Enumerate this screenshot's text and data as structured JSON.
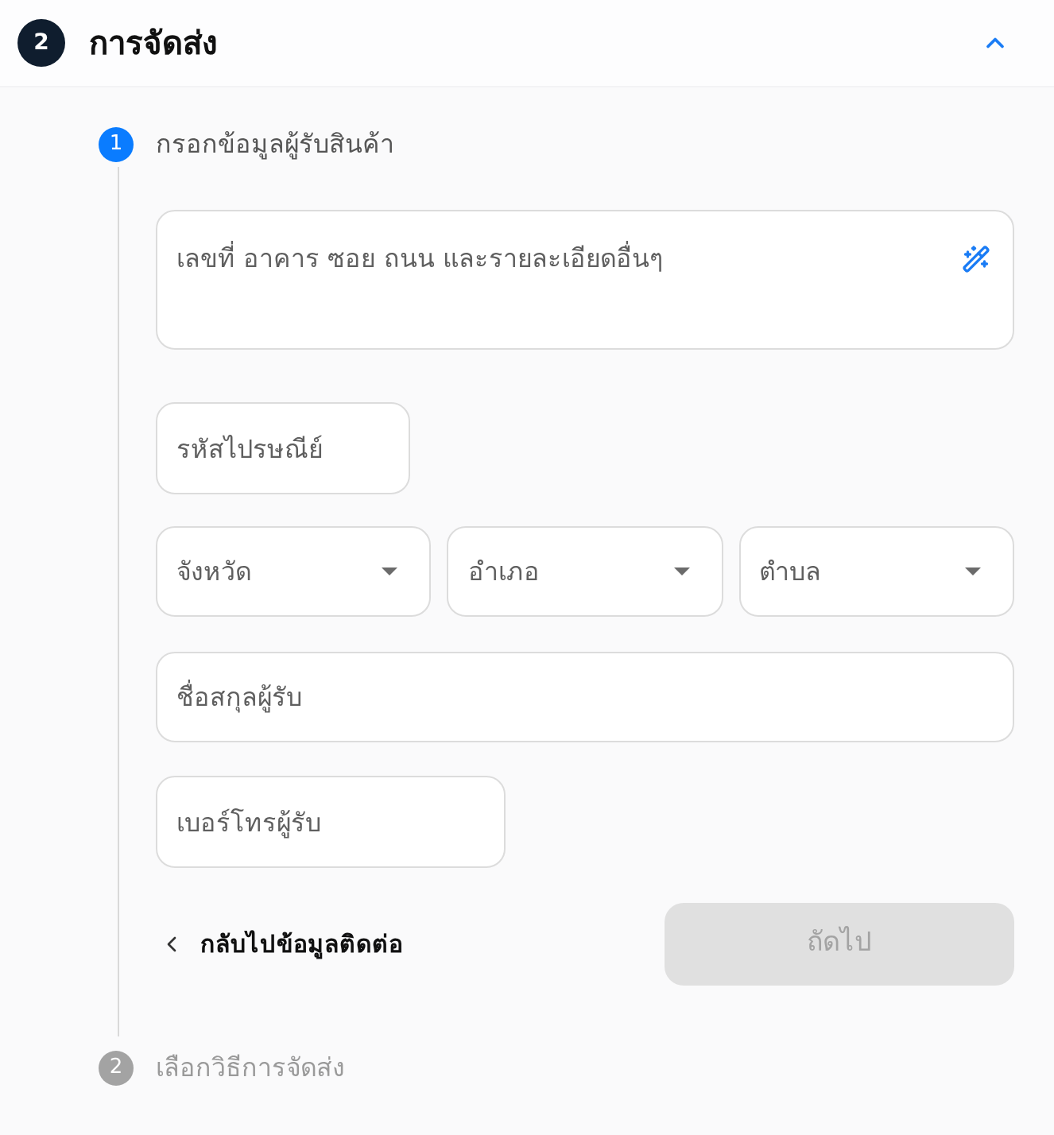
{
  "section": {
    "number": "2",
    "title": "การจัดส่ง",
    "expanded": true
  },
  "steps": [
    {
      "number": "1",
      "label": "กรอกข้อมูลผู้รับสินค้า",
      "active": true
    },
    {
      "number": "2",
      "label": "เลือกวิธีการจัดส่ง",
      "active": false
    }
  ],
  "form": {
    "address": {
      "placeholder": "เลขที่ อาคาร ซอย ถนน และรายละเอียดอื่นๆ"
    },
    "postal_code": {
      "placeholder": "รหัสไปรษณีย์"
    },
    "dropdowns": [
      {
        "placeholder": "จังหวัด"
      },
      {
        "placeholder": "อำเภอ"
      },
      {
        "placeholder": "ตำบล"
      }
    ],
    "recipient_name": {
      "placeholder": "ชื่อสกุลผู้รับ"
    },
    "phone": {
      "placeholder": "เบอร์โทรผู้รับ"
    },
    "back_link": {
      "label": "กลับไปข้อมูลติดต่อ"
    },
    "next_button": {
      "label": "ถัดไป",
      "disabled": true
    }
  }
}
